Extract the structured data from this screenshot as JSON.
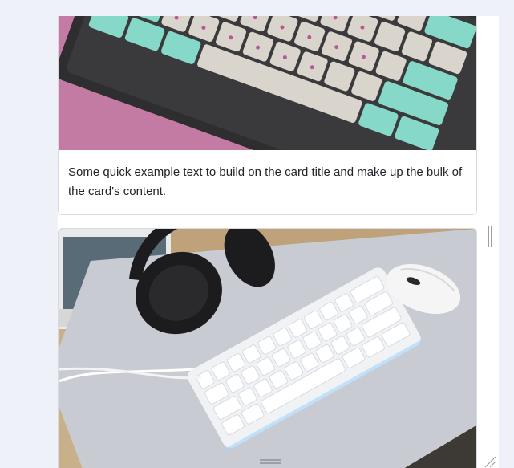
{
  "cards": [
    {
      "image_alt": "keyboard-photo",
      "text": "Some quick example text to build on the card title and make up the bulk of the card's content."
    },
    {
      "image_alt": "headphones-keyboard-photo"
    }
  ],
  "colors": {
    "page_background": "#eef1f7",
    "card_border": "#d7dade",
    "body_text": "#212529"
  },
  "icons": [
    "split-handle-icon",
    "drag-handle-icon",
    "resize-grip-icon"
  ]
}
